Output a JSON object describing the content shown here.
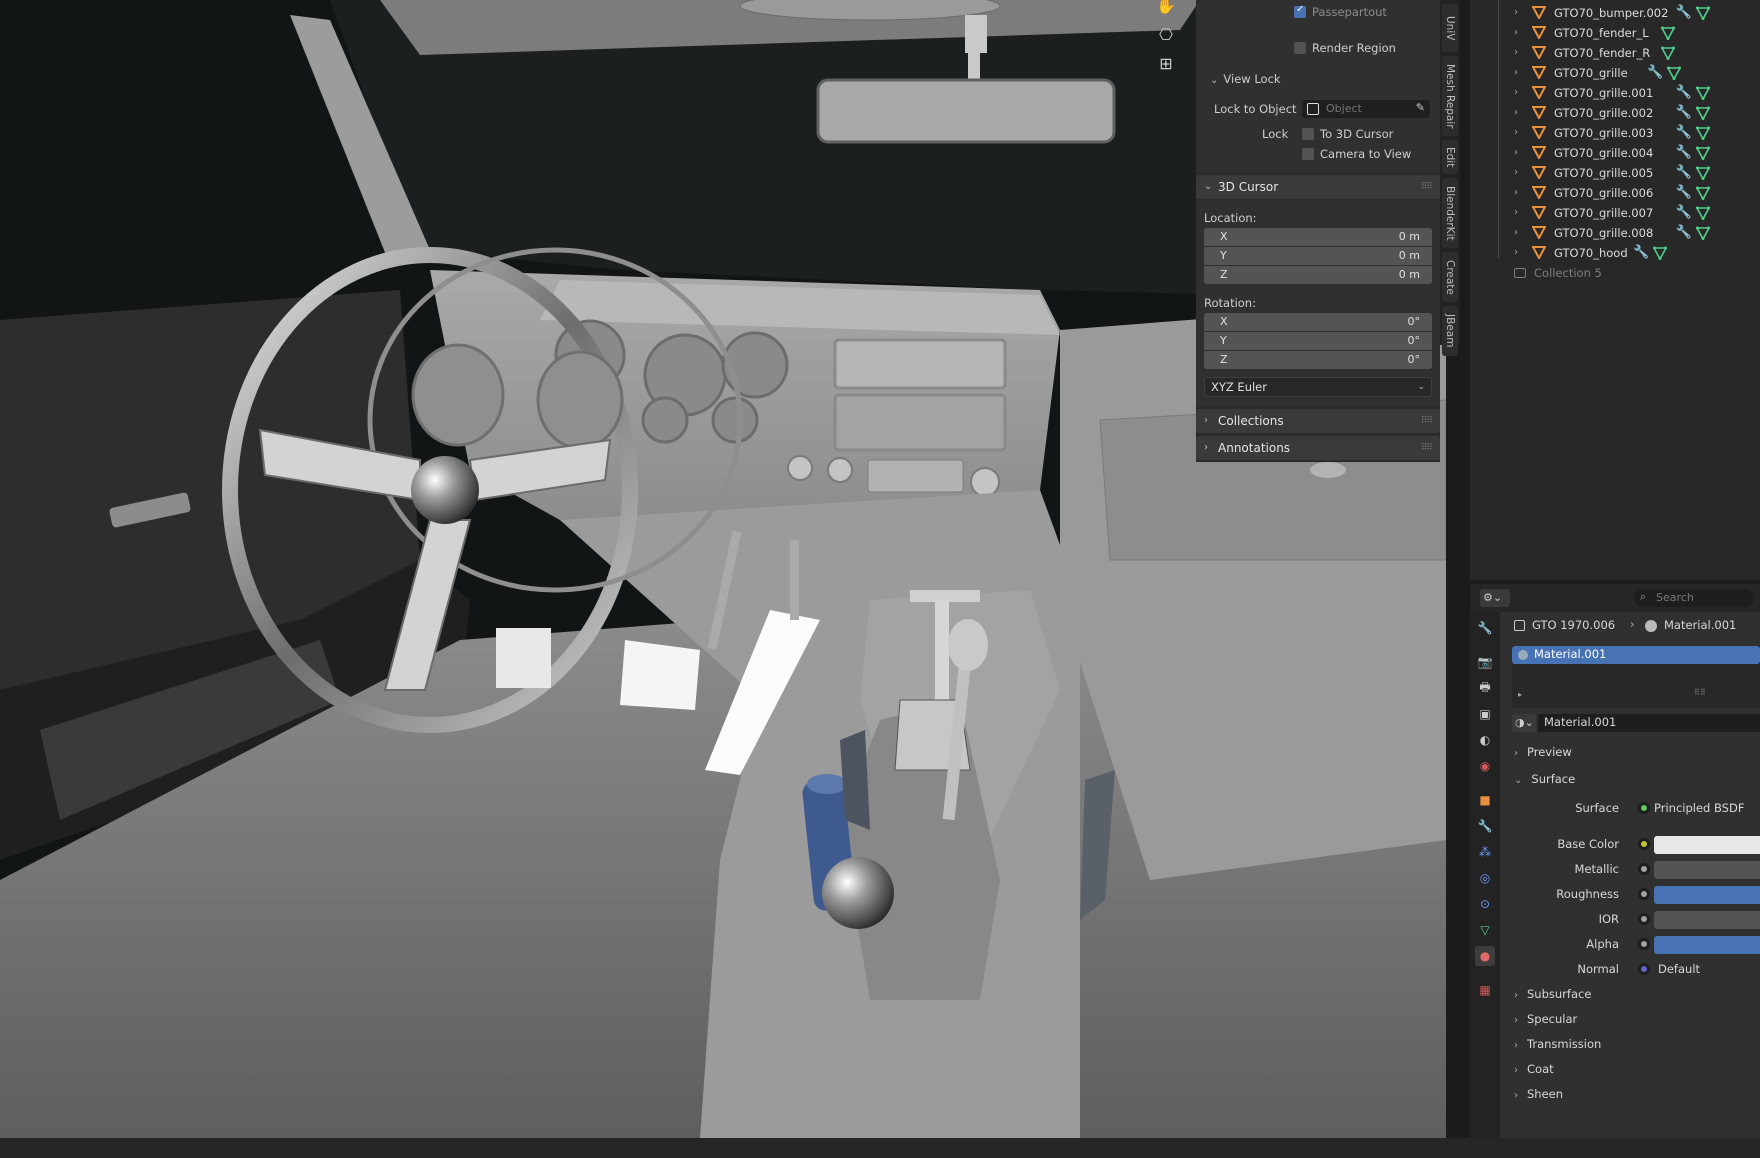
{
  "npanel": {
    "passepartout_label": "Passepartout",
    "render_region_label": "Render Region",
    "view_lock_title": "View Lock",
    "lock_to_object_label": "Lock to Object",
    "lock_to_object_placeholder": "Object",
    "lock_label": "Lock",
    "to_3d_cursor_label": "To 3D Cursor",
    "camera_to_view_label": "Camera to View",
    "cursor_title": "3D Cursor",
    "location_label": "Location:",
    "loc_x_label": "X",
    "loc_x": "0 m",
    "loc_y_label": "Y",
    "loc_y": "0 m",
    "loc_z_label": "Z",
    "loc_z": "0 m",
    "rotation_label": "Rotation:",
    "rot_x_label": "X",
    "rot_x": "0°",
    "rot_y_label": "Y",
    "rot_y": "0°",
    "rot_z_label": "Z",
    "rot_z": "0°",
    "rotation_mode": "XYZ Euler",
    "collections_title": "Collections",
    "annotations_title": "Annotations"
  },
  "sidetabs": [
    "UniV",
    "Mesh Repair",
    "Edit",
    "BlenderKit",
    "Create",
    "JBeam"
  ],
  "outliner": {
    "items": [
      {
        "name": "GTO70_bumper.002",
        "has_modifier": true
      },
      {
        "name": "GTO70_fender_L",
        "has_modifier": false
      },
      {
        "name": "GTO70_fender_R",
        "has_modifier": false
      },
      {
        "name": "GTO70_grille",
        "has_modifier": true
      },
      {
        "name": "GTO70_grille.001",
        "has_modifier": true
      },
      {
        "name": "GTO70_grille.002",
        "has_modifier": true
      },
      {
        "name": "GTO70_grille.003",
        "has_modifier": true
      },
      {
        "name": "GTO70_grille.004",
        "has_modifier": true
      },
      {
        "name": "GTO70_grille.005",
        "has_modifier": true
      },
      {
        "name": "GTO70_grille.006",
        "has_modifier": true
      },
      {
        "name": "GTO70_grille.007",
        "has_modifier": true
      },
      {
        "name": "GTO70_grille.008",
        "has_modifier": true
      },
      {
        "name": "GTO70_hood",
        "has_modifier": true
      }
    ],
    "collection_label": "Collection 5"
  },
  "properties": {
    "search_placeholder": "Search",
    "breadcrumb_object": "GTO 1970.006",
    "breadcrumb_material": "Material.001",
    "slot_name": "Material.001",
    "material_name": "Material.001",
    "preview_label": "Preview",
    "surface_section": "Surface",
    "surface_label": "Surface",
    "surface_value": "Principled BSDF",
    "base_color_label": "Base Color",
    "metallic_label": "Metallic",
    "roughness_label": "Roughness",
    "ior_label": "IOR",
    "alpha_label": "Alpha",
    "normal_label": "Normal",
    "normal_value": "Default",
    "subpanels": [
      "Subsurface",
      "Specular",
      "Transmission",
      "Coat",
      "Sheen"
    ],
    "colors": {
      "accent": "#4772b3",
      "base_color": "#e8e8e8",
      "socket_yellow": "#c7c729",
      "socket_gray": "#a1a1a1",
      "socket_blue": "#6363c7",
      "socket_green": "#63c763"
    }
  }
}
